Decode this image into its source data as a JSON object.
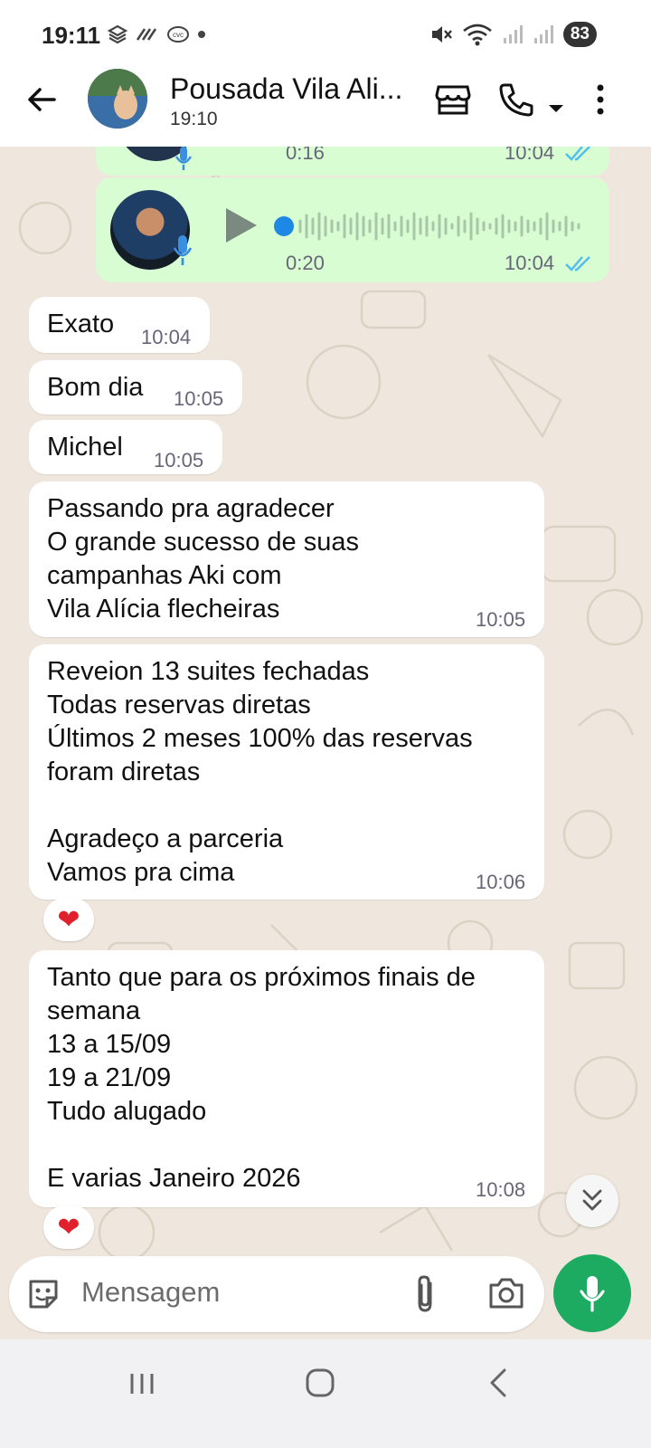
{
  "status_bar": {
    "time": "19:11",
    "battery": "83"
  },
  "header": {
    "contact_name": "Pousada Vila Ali...",
    "subtitle": "19:10",
    "icons": [
      "back-arrow-icon",
      "store-icon",
      "phone-icon",
      "dropdown-icon",
      "more-vert-icon"
    ]
  },
  "messages": {
    "voice1": {
      "duration": "0:16",
      "time": "10:04"
    },
    "voice2": {
      "duration": "0:20",
      "time": "10:04"
    },
    "m1": {
      "text": "Exato",
      "time": "10:04"
    },
    "m2": {
      "text": "Bom dia",
      "time": "10:05"
    },
    "m3": {
      "text": "Michel",
      "time": "10:05"
    },
    "m4": {
      "text": "Passando pra agradecer\nO grande sucesso de suas\ncampanhas Aki com\nVila Alícia flecheiras",
      "time": "10:05"
    },
    "m5": {
      "text": "Reveion 13 suites fechadas\nTodas reservas diretas\nÚltimos 2 meses 100% das reservas\nforam diretas\n\nAgradeço a parceria\nVamos pra cima",
      "time": "10:06",
      "reaction": "❤"
    },
    "m6": {
      "text": "Tanto que para os próximos finais de\nsemana\n13 a 15/09\n19 a 21/09\nTudo alugado\n\nE varias Janeiro 2026",
      "time": "10:08",
      "reaction": "❤"
    }
  },
  "composer": {
    "placeholder": "Mensagem"
  },
  "colors": {
    "outgoing_bubble": "#d8fdd2",
    "incoming_bubble": "#ffffff",
    "chat_background": "#efe7dd",
    "accent_green": "#1daa61",
    "read_ticks": "#53bdeb"
  }
}
